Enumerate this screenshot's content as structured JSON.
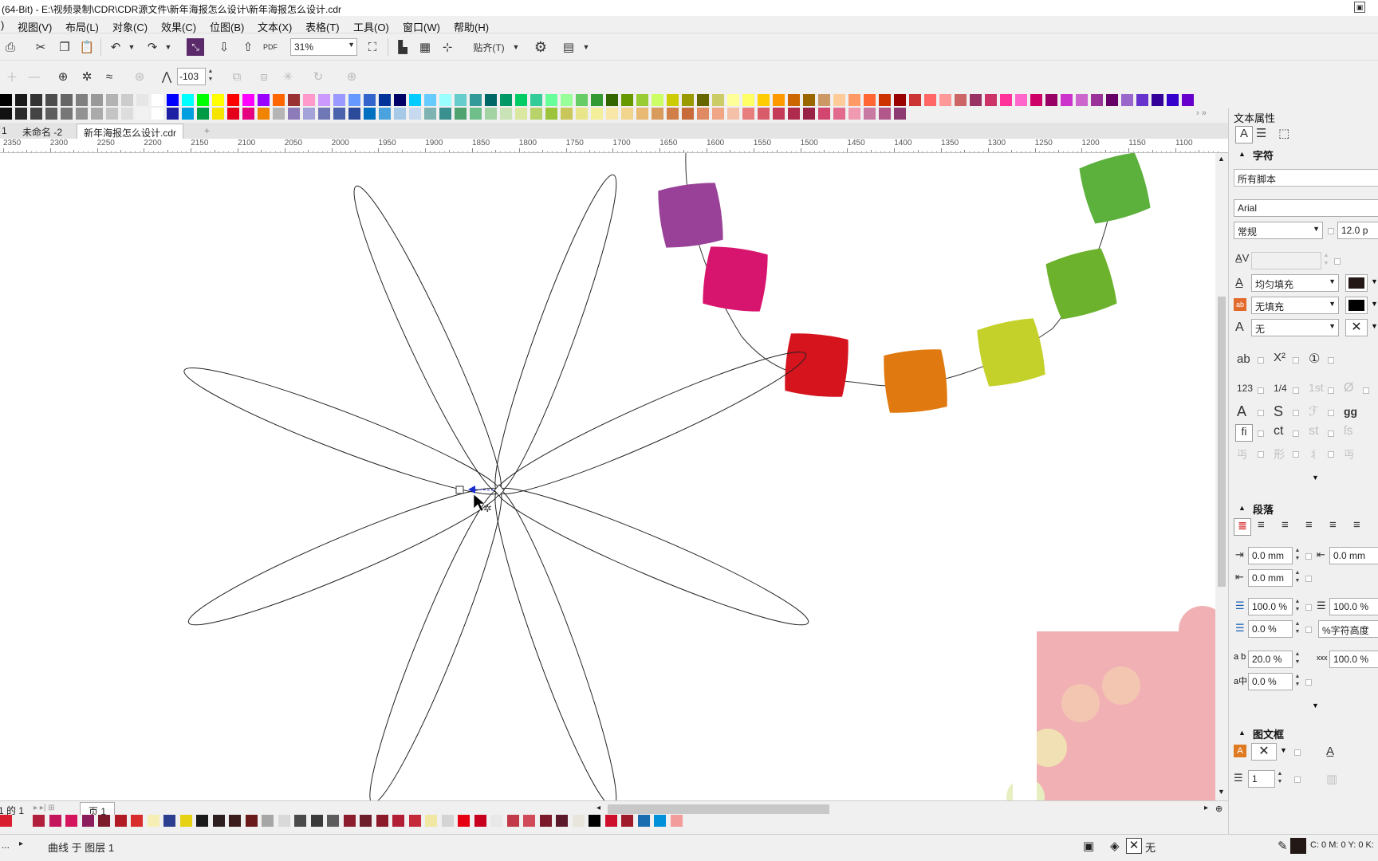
{
  "window": {
    "title": "(64-Bit) - E:\\视频录制\\CDR\\CDR源文件\\新年海报怎么设计\\新年海报怎么设计.cdr"
  },
  "menu": {
    "first": ")",
    "items": [
      "视图(V)",
      "布局(L)",
      "对象(C)",
      "效果(C)",
      "位图(B)",
      "文本(X)",
      "表格(T)",
      "工具(O)",
      "窗口(W)",
      "帮助(H)"
    ]
  },
  "toolbar": {
    "zoom": "31%",
    "snap_label": "贴齐(T)",
    "pdf_label": "PDF"
  },
  "propertybar": {
    "smooth_value": "-103"
  },
  "doc_tabs": {
    "left_fragment": "1",
    "tab1": "未命名 -2",
    "tab2": "新年海报怎么设计.cdr",
    "add": "+"
  },
  "ruler": {
    "labels": [
      "2350",
      "2300",
      "2250",
      "2200",
      "2150",
      "2100",
      "2050",
      "2000",
      "1950",
      "1900",
      "1850",
      "1800",
      "1750",
      "1700",
      "1650",
      "1600",
      "1550",
      "1500",
      "1450",
      "1400",
      "1350",
      "1300",
      "1250",
      "1200",
      "1150",
      "1100"
    ]
  },
  "canvas": {
    "beads": [
      {
        "name": "purple",
        "color": "#994198"
      },
      {
        "name": "magenta",
        "color": "#d8156e"
      },
      {
        "name": "red",
        "color": "#d5141e"
      },
      {
        "name": "orange",
        "color": "#e0790f"
      },
      {
        "name": "yellow-green",
        "color": "#c5d12b"
      },
      {
        "name": "green",
        "color": "#6cb22d"
      },
      {
        "name": "green-top",
        "color": "#5cb03c"
      }
    ],
    "corner_colors": {
      "pink": "#f1b1b4",
      "peach": "#f3c6b2",
      "cream": "#f1e0b3",
      "pale-green": "#e7efc0"
    }
  },
  "page_bar": {
    "page_counter": "1 的 1",
    "page_tab": "页 1"
  },
  "status": {
    "menu_arrow": "...",
    "object_info": "曲线 于 图层 1",
    "fill_none": "无",
    "color_readout": "C: 0 M: 0 Y: 0 K:"
  },
  "panel": {
    "title": "文本属性",
    "char_section": "字符",
    "script": "所有脚本",
    "font": "Arial",
    "style": "常规",
    "size": "12.0 p",
    "fill1": "均匀填充",
    "fill2": "无填充",
    "outline": "无",
    "para_section": "段落",
    "indent_left": "0.0 mm",
    "indent_right": "0.0 mm",
    "indent_first": "0.0 mm",
    "line_spacing": "100.0 %",
    "line_spacing_r": "100.0 %",
    "before_para": "0.0 %",
    "unit_label": "%字符高度",
    "char_spacing_label": "a b",
    "char_spacing": "20.0 %",
    "word_spacing_label": "xxx",
    "word_spacing": "100.0 %",
    "lang_spacing_label": "a中",
    "lang_spacing": "0.0 %",
    "frame_section": "图文框",
    "columns": "1",
    "icon_labels": {
      "ab": "ab",
      "x2": "X²",
      "circle1": "①",
      "n123": "123",
      "frac": "1/4",
      "st1": "1st",
      "zero": "Ø",
      "A": "A",
      "S": "S",
      "gg": "gg",
      "fi": "fi",
      "ct": "ct",
      "st": "st",
      "fs": "ſs",
      "shape": "形"
    }
  },
  "colors": {
    "palette_top_row1": [
      "#000000",
      "#1a1a1a",
      "#333333",
      "#4d4d4d",
      "#666666",
      "#808080",
      "#999999",
      "#b3b3b3",
      "#cccccc",
      "#e6e6e6",
      "#ffffff",
      "#0000ff",
      "#00ffff",
      "#00ff00",
      "#ffff00",
      "#ff0000",
      "#ff00ff",
      "#9900ff",
      "#ff6600",
      "#993333",
      "#ff99cc",
      "#cc99ff",
      "#9999ff",
      "#6699ff",
      "#3366cc",
      "#003399",
      "#000066",
      "#00ccff",
      "#66ccff",
      "#99ffff",
      "#66cccc",
      "#339999",
      "#006666",
      "#009966",
      "#00cc66",
      "#33cc99",
      "#66ff99",
      "#99ff99",
      "#66cc66",
      "#339933",
      "#336600",
      "#669900",
      "#99cc33",
      "#ccff66",
      "#cccc00",
      "#999900",
      "#666600",
      "#cccc66",
      "#ffff99",
      "#ffff66",
      "#ffcc00",
      "#ff9900",
      "#cc6600",
      "#996600",
      "#cc9966",
      "#ffcc99",
      "#ff9966",
      "#ff6633",
      "#cc3300",
      "#990000",
      "#cc3333",
      "#ff6666",
      "#ff9999",
      "#cc6666",
      "#993366",
      "#cc3366",
      "#ff3399",
      "#ff66cc",
      "#cc0066",
      "#990066",
      "#cc33cc",
      "#cc66cc",
      "#993399",
      "#660066",
      "#9966cc",
      "#6633cc",
      "#330099",
      "#3300cc",
      "#6600cc",
      "#9999cc"
    ],
    "palette_top_row2": [
      "#111111",
      "#2b2b2b",
      "#444444",
      "#5e5e5e",
      "#777777",
      "#919191",
      "#aaaaaa",
      "#c4c4c4",
      "#dddddd",
      "#f2f2f2",
      "#ffffff",
      "#1f1fa3",
      "#00a0e0",
      "#009a44",
      "#f5e300",
      "#e4001b",
      "#e4007f",
      "#f08300",
      "#b5b5b5",
      "#8c7bb8",
      "#a3a3d9",
      "#6f77b5",
      "#4b63ad",
      "#2c4a9a",
      "#0070c0",
      "#4aa3df",
      "#a7c9e8",
      "#c7d9ee",
      "#7fb3b3",
      "#3a8f8f",
      "#4fa36e",
      "#6fbf8a",
      "#a3d3a3",
      "#c9e3b6",
      "#d9e7a0",
      "#b9d36b",
      "#9cc43a",
      "#c9c75a",
      "#e8e58a",
      "#f4ef9b",
      "#f9e7a8",
      "#f2d58c",
      "#e8b972",
      "#d99b5b",
      "#d07f49",
      "#c86b3a",
      "#e08a63",
      "#f0a585",
      "#f4c0a8",
      "#e87d7d",
      "#d95c6b",
      "#c43b5a",
      "#b02a4d",
      "#992247",
      "#d1456e",
      "#e26a8c",
      "#ef9ab1",
      "#c97aa3",
      "#b1578a",
      "#8e3a72"
    ],
    "palette_bottom": [
      "#d71f2f",
      "#f0f0f0",
      "#b11f3c",
      "#c4145c",
      "#d4145c",
      "#8c1d5c",
      "#7c1b2c",
      "#b11b24",
      "#d92d2d",
      "#f5efb5",
      "#2b3e8f",
      "#e6d212",
      "#1a1a1a",
      "#2d1f1f",
      "#3b1d1d",
      "#6a1a1a",
      "#a6a6a6",
      "#d9d9d9",
      "#4a4a4a",
      "#3a3a3a",
      "#5c5c5c",
      "#8c1d2c",
      "#6d1d2a",
      "#8b1a2b",
      "#b21e35",
      "#c42a3a",
      "#f0e7a5",
      "#d4d4d4",
      "#e60012",
      "#c7001f",
      "#e8e8e8",
      "#c23a4a",
      "#d14a5a",
      "#7a1a2a",
      "#5a1a2a",
      "#e8e6dc",
      "#000000",
      "#ce0f2b",
      "#9f1b2b",
      "#1a6cb0",
      "#0091db",
      "#f39c9c"
    ]
  }
}
